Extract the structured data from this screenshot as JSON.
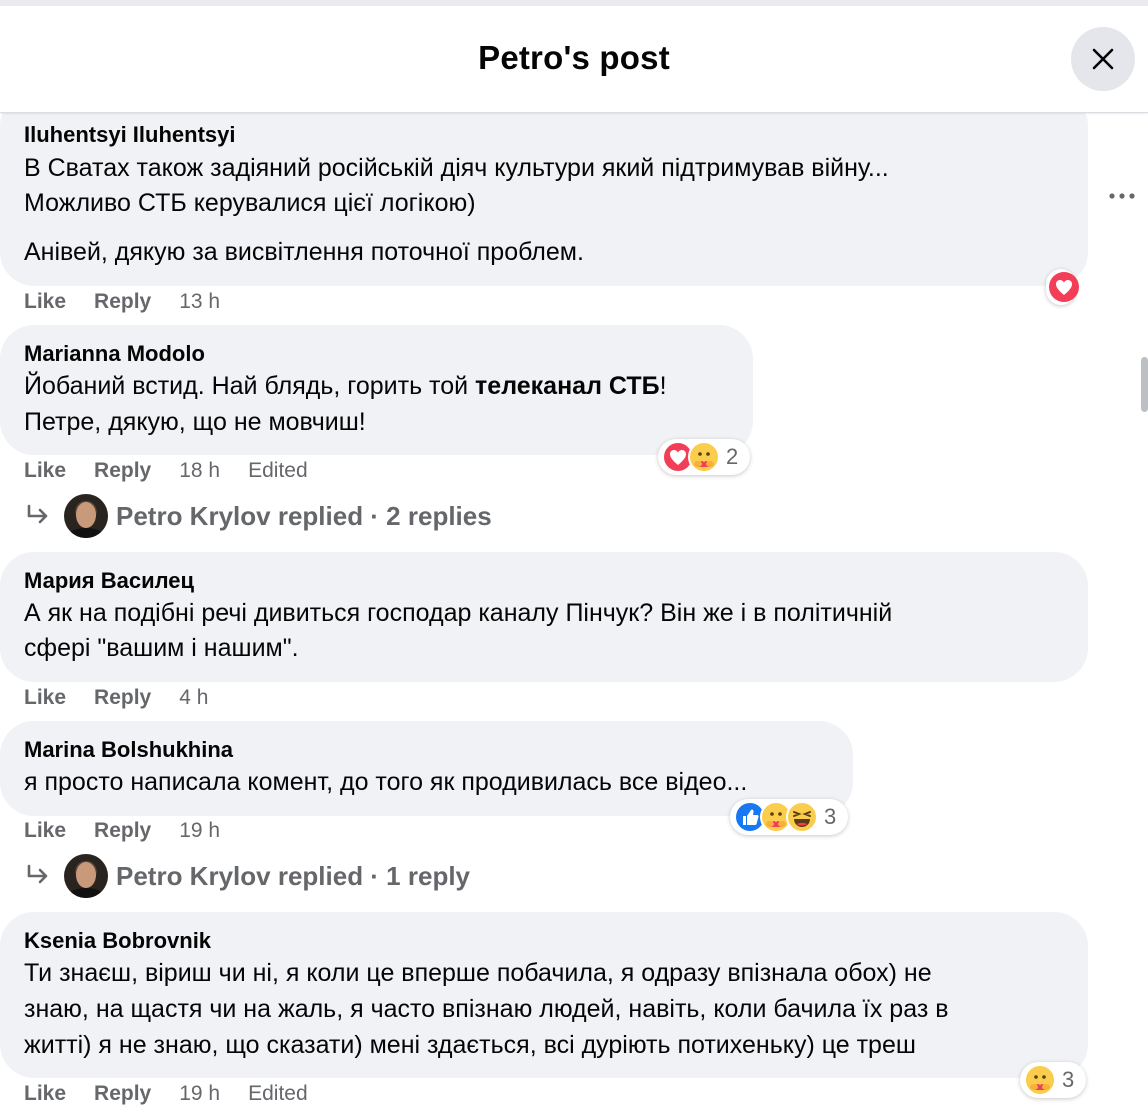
{
  "header": {
    "title": "Petro's post"
  },
  "comments": [
    {
      "author": "Iluhentsyi Iluhentsyi",
      "lines": [
        "В Сватах також задіяний російській діяч культури який підтримував війну...",
        "Можливо СТБ керувалися цієї логікою)",
        "Анівей, дякую за висвітлення поточної проблем."
      ],
      "actions": {
        "like": "Like",
        "reply": "Reply",
        "time": "13 h"
      }
    },
    {
      "author": "Marianna Modolo",
      "line1_pre": "Йобаний встид. Най блядь, горить той ",
      "line1_bold": "телеканал СТБ",
      "line1_post": "!",
      "line2": "Петре, дякую, що не мовчиш!",
      "actions": {
        "like": "Like",
        "reply": "Reply",
        "time": "18 h",
        "edited": "Edited"
      },
      "reaction_count": "2",
      "replies": "Petro Krylov replied · 2 replies"
    },
    {
      "author": "Мария Василец",
      "lines": [
        "А як на подібні речі дивиться господар каналу Пінчук? Він же і в політичній",
        "сфері \"вашим і нашим\"."
      ],
      "actions": {
        "like": "Like",
        "reply": "Reply",
        "time": "4 h"
      }
    },
    {
      "author": "Marina Bolshukhina",
      "lines": [
        "я просто написала комент, до того як продивилась все відео..."
      ],
      "actions": {
        "like": "Like",
        "reply": "Reply",
        "time": "19 h"
      },
      "reaction_count": "3",
      "replies": "Petro Krylov replied · 1 reply"
    },
    {
      "author": "Ksenia Bobrovnik",
      "lines": [
        "Ти знаєш, віриш чи ні, я коли це вперше побачила, я одразу впізнала обох) не",
        "знаю, на щастя чи на жаль, я часто впізнаю людей, навіть, коли бачила їх раз в",
        "житті) я не знаю, що сказати) мені здається, всі дурiють потихеньку) це треш"
      ],
      "actions": {
        "like": "Like",
        "reply": "Reply",
        "time": "19 h",
        "edited": "Edited"
      },
      "reaction_count": "3"
    }
  ],
  "icons": {
    "close": "close-icon",
    "more": "more-horizontal-icon",
    "love": "love-reaction-icon",
    "care": "care-reaction-icon",
    "like": "like-reaction-icon",
    "haha": "haha-reaction-icon",
    "reply_arrow": "reply-arrow-icon"
  },
  "colors": {
    "bubble": "#f0f2f5",
    "secondary_text": "#65676b",
    "love": "#f33e58",
    "like": "#1877f2",
    "emoji": "#fbcd4c"
  }
}
